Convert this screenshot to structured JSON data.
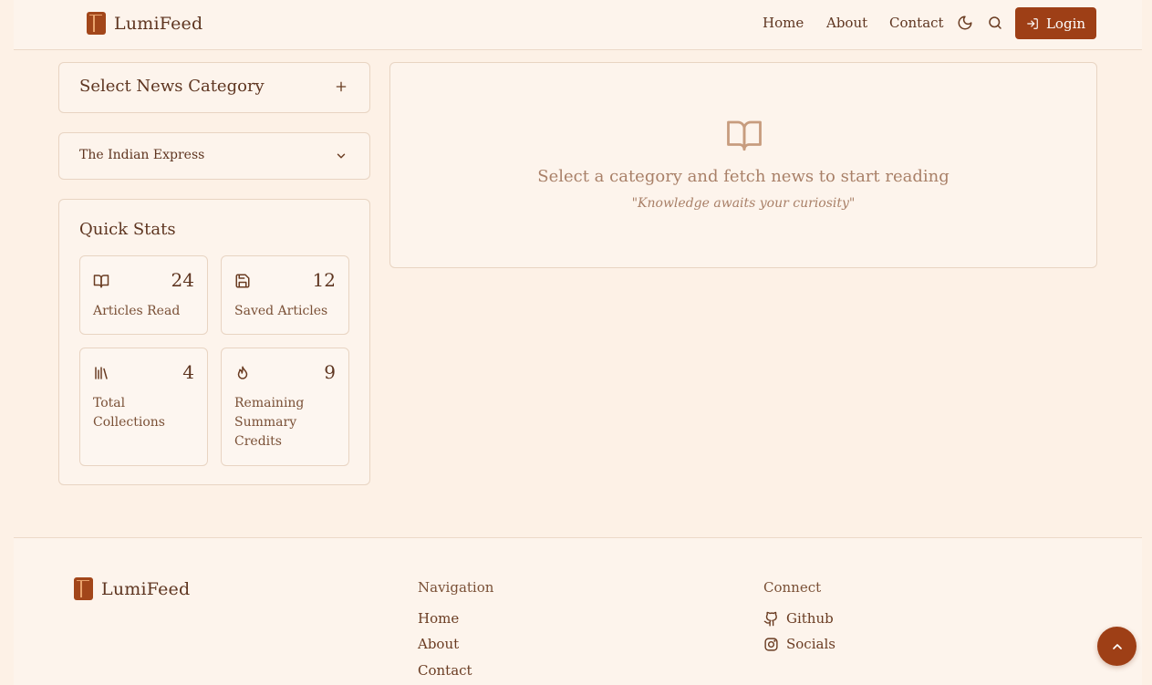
{
  "brand": {
    "name": "LumiFeed"
  },
  "header": {
    "nav": [
      "Home",
      "About",
      "Contact"
    ],
    "login_label": "Login",
    "icons": [
      "moon-icon",
      "search-icon",
      "login-icon"
    ]
  },
  "sidebar": {
    "category_title": "Select News Category",
    "source_selected": "The Indian Express",
    "stats_title": "Quick Stats",
    "stats": [
      {
        "value": "24",
        "label": "Articles Read",
        "icon": "book-open-icon"
      },
      {
        "value": "12",
        "label": "Saved Articles",
        "icon": "save-icon"
      },
      {
        "value": "4",
        "label": "Total Collections",
        "icon": "library-icon"
      },
      {
        "value": "9",
        "label": "Remaining Summary Credits",
        "icon": "flame-icon"
      }
    ]
  },
  "main": {
    "empty_title": "Select a category and fetch news to start reading",
    "empty_quote": "\"Knowledge awaits your curiosity\""
  },
  "footer": {
    "brand": "LumiFeed",
    "nav_title": "Navigation",
    "nav_links": [
      "Home",
      "About",
      "Contact"
    ],
    "connect_title": "Connect",
    "connect_links": [
      "Github",
      "Socials"
    ]
  },
  "colors": {
    "accent": "#9e3f16",
    "background": "#fdf1e6",
    "text": "#5e3520"
  }
}
